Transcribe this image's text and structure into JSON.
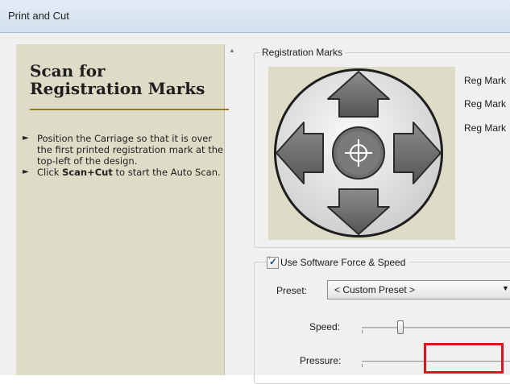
{
  "window": {
    "title": "Print and Cut"
  },
  "help_panel": {
    "heading_line1": "Scan for",
    "heading_line2": "Registration Marks",
    "step1": "Position the Carriage so that it is over the first printed registration mark at the top-left of the design.",
    "step2_prefix": "Click ",
    "step2_bold": "Scan+Cut",
    "step2_suffix": " to start the Auto Scan."
  },
  "registration": {
    "group_label": "Registration Marks",
    "mark_labels": [
      "Reg Mark",
      "Reg Mark",
      "Reg Mark"
    ],
    "joypad_icons": [
      "arrow-up-icon",
      "arrow-left-icon",
      "crosshair-icon",
      "arrow-right-icon",
      "arrow-down-icon"
    ]
  },
  "force_speed": {
    "checkbox_label": "Use Software Force  & Speed",
    "checked": true,
    "preset_label": "Preset:",
    "preset_value": "< Custom Preset >",
    "speed_label": "Speed:",
    "pressure_label": "Pressure:"
  },
  "colors": {
    "accent_rule": "#9a7a28",
    "highlight": "#e0141a",
    "help_bg": "#dedbc6"
  }
}
